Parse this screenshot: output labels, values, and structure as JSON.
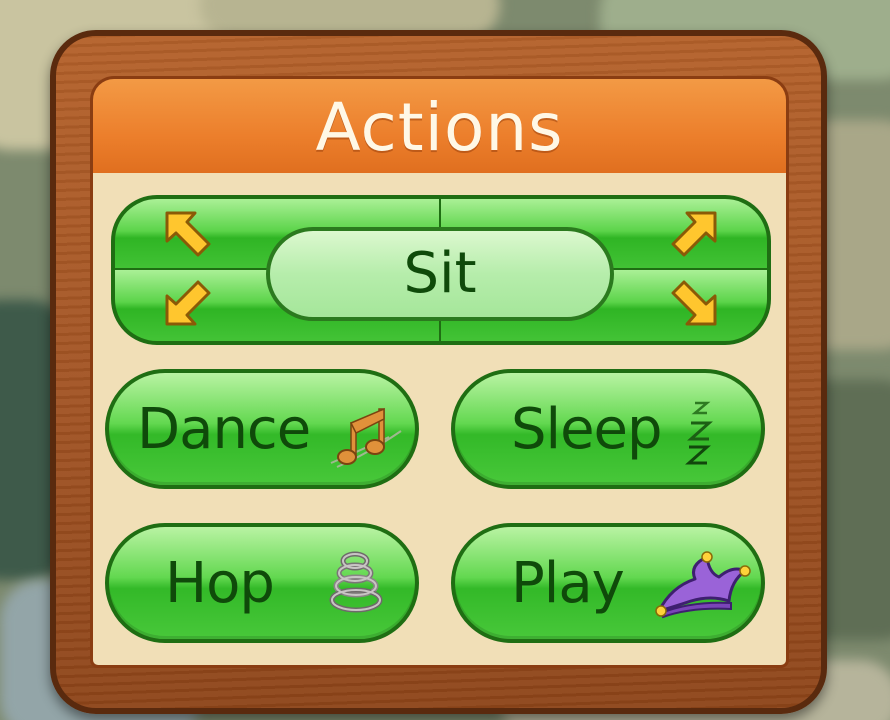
{
  "panel": {
    "title": "Actions"
  },
  "actions": {
    "sit_label": "Sit",
    "dance_label": "Dance",
    "sleep_label": "Sleep",
    "hop_label": "Hop",
    "play_label": "Play"
  },
  "icons": {
    "sit_up_left": "arrow-up-left-icon",
    "sit_up_right": "arrow-up-right-icon",
    "sit_down_left": "arrow-down-left-icon",
    "sit_down_right": "arrow-down-right-icon",
    "dance": "music-notes-icon",
    "sleep": "zzz-icon",
    "hop": "spring-icon",
    "play": "jester-hat-icon"
  },
  "colors": {
    "header": "#ec7f2c",
    "panel_frame": "#a35424",
    "panel_body": "#f1dfb7",
    "button_green": "#48c83a",
    "button_text": "#0f4a0a",
    "arrow_yellow": "#ffc62e"
  }
}
